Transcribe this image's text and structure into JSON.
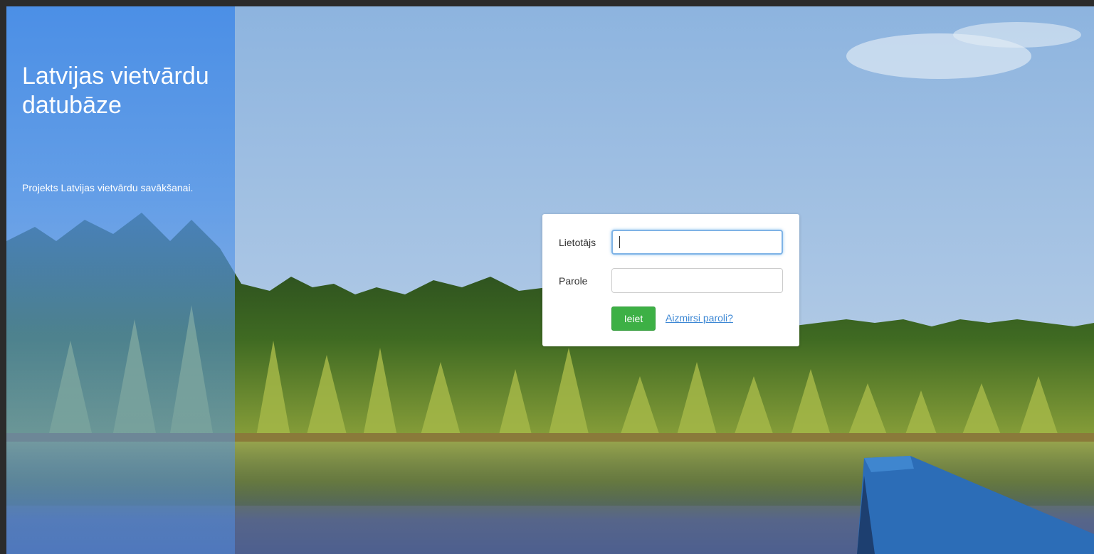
{
  "sidebar": {
    "title": "Latvijas vietvārdu datubāze",
    "subtitle": "Projekts Latvijas vietvārdu savākšanai."
  },
  "login": {
    "user_label": "Lietotājs",
    "user_value": "",
    "password_label": "Parole",
    "password_value": "",
    "submit_label": "Ieiet",
    "forgot_label": "Aizmirsi paroli?"
  },
  "colors": {
    "panel_blue": "#5a96e6",
    "submit_green": "#3db045",
    "link_blue": "#3c87d4"
  },
  "background": {
    "icon": "lake-forest-photo"
  }
}
